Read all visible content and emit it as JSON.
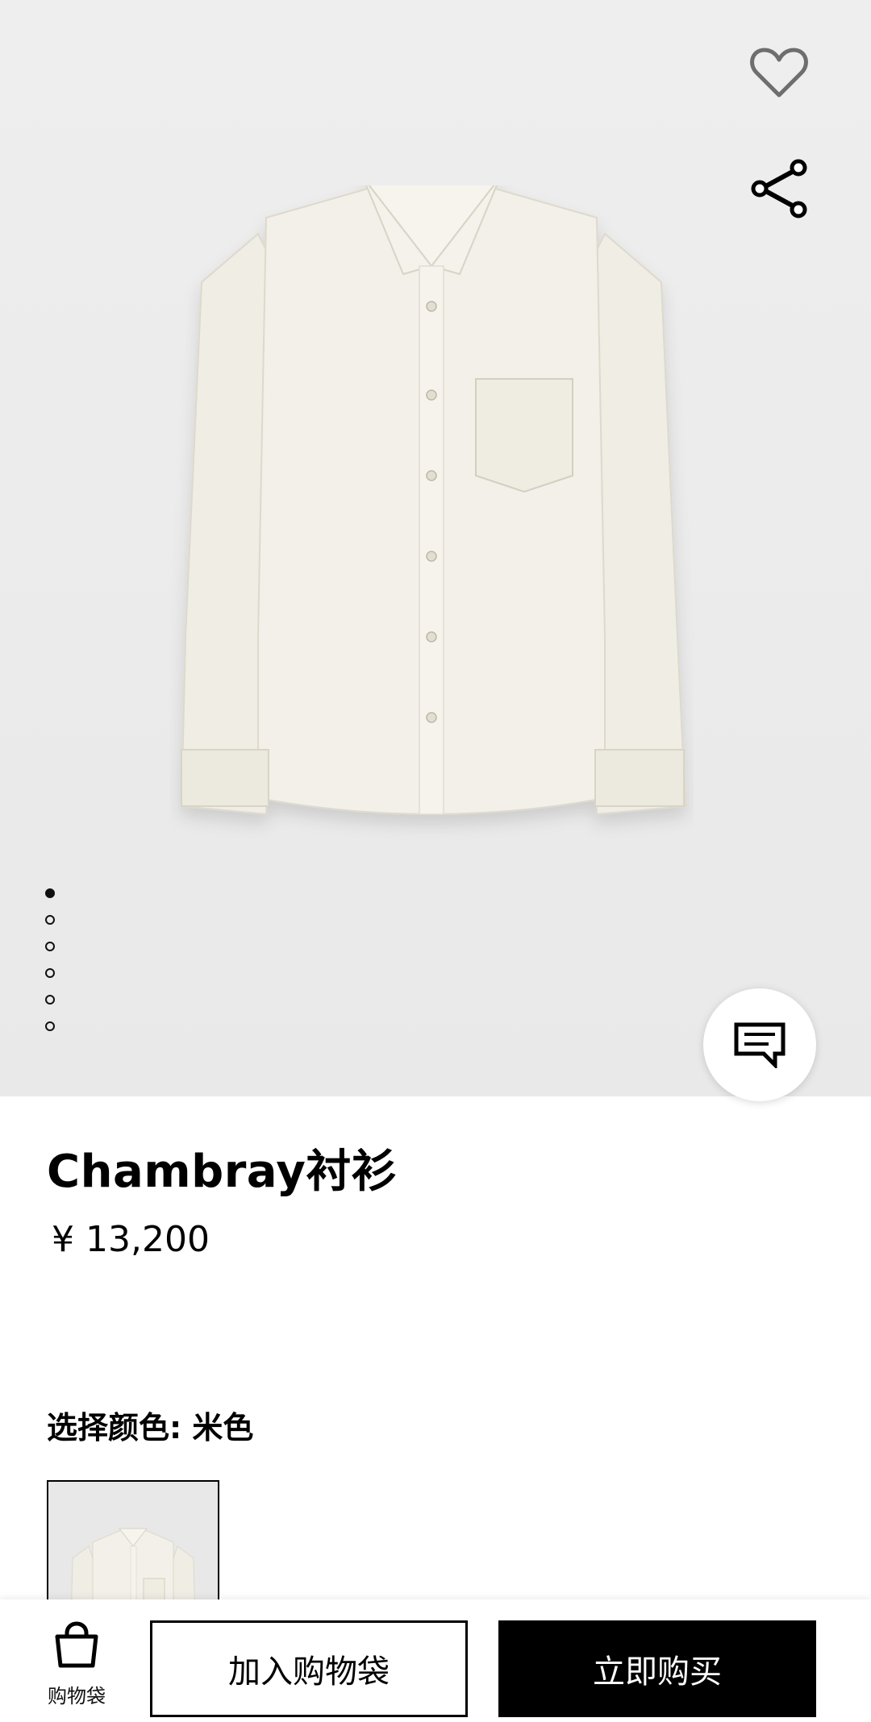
{
  "product": {
    "name": "Chambray衬衫",
    "price": "¥ 13,200",
    "image_count": 6,
    "active_image": 1
  },
  "color": {
    "label": "选择颜色: 米色"
  },
  "actions": {
    "bag_label": "购物袋",
    "add_to_bag": "加入购物袋",
    "buy_now": "立即购买"
  },
  "icons": {
    "favorite": "heart-icon",
    "share": "share-icon",
    "chat": "chat-icon",
    "bag": "shopping-bag-icon"
  },
  "colors": {
    "hero_bg": "#ececec",
    "primary": "#000000",
    "shirt": "#f1efe6"
  }
}
